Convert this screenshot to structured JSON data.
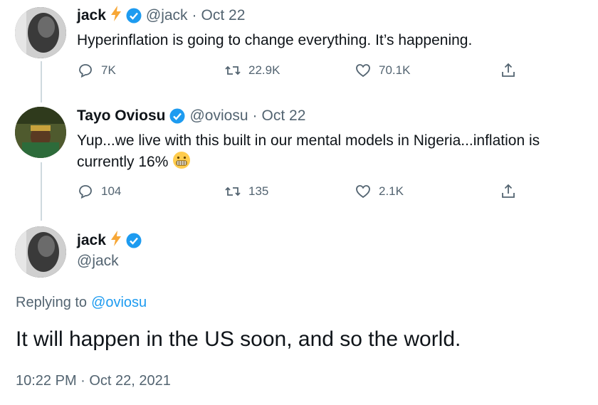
{
  "tweet1": {
    "name": "jack",
    "handle": "@jack",
    "dot": "·",
    "date": "Oct 22",
    "text": "Hyperinflation is going to change everything. It’s happening.",
    "replies": "7K",
    "retweets": "22.9K",
    "likes": "70.1K"
  },
  "tweet2": {
    "name": "Tayo Oviosu",
    "handle": "@oviosu",
    "dot": "·",
    "date": "Oct 22",
    "text_line1": "Yup...we live with this built in our mental models in Nigeria...inflation is",
    "text_line2": "currently 16%",
    "emoji": "😬",
    "replies": "104",
    "retweets": "135",
    "likes": "2.1K"
  },
  "tweet3": {
    "name": "jack",
    "handle": "@jack",
    "replying_prefix": "Replying to",
    "replying_to": "@oviosu",
    "text": "It will happen in the US soon, and so the world.",
    "timestamp": "10:22 PM · Oct 22, 2021"
  },
  "colors": {
    "verified": "#1d9bf0",
    "bolt": "#f7a736",
    "muted": "#536471",
    "link": "#1d9bf0"
  },
  "icons": [
    "reply-icon",
    "retweet-icon",
    "like-icon",
    "share-icon",
    "verified-icon",
    "lightning-icon",
    "grimace-emoji"
  ]
}
